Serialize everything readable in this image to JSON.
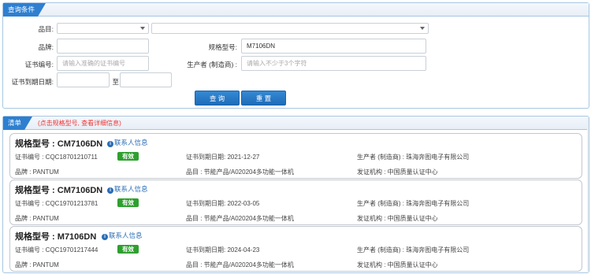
{
  "query": {
    "title": "查询条件",
    "category_label": "品目:",
    "brand_label": "品牌:",
    "brand_value": "",
    "model_label": "规格型号:",
    "model_value": "M7106DN",
    "cert_label": "证书编号:",
    "cert_placeholder": "请输入准确的证书编号",
    "producer_label": "生产者  (制造商) :",
    "producer_placeholder": "请输入不少于3个字符",
    "expire_label": "证书到期日期:",
    "to_label": "至",
    "search_button": "查 询",
    "reset_button": "重 置"
  },
  "list": {
    "title": "清单",
    "hint": "(点击规格型号, 查看详细信息)",
    "items": [
      {
        "model": "规格型号 : CM7106DN",
        "contact": "联系人信息",
        "cert_no": "证书编号 : CQC18701210711",
        "status": "有效",
        "expire": "证书到期日期: 2021-12-27",
        "producer": "生产者  (制造商) : 珠海奔图电子有限公司",
        "brand": "品牌 : PANTUM",
        "category": "品目 : 节能产品/A020204多功能一体机",
        "issuer": "发证机构 : 中国质量认证中心"
      },
      {
        "model": "规格型号 : CM7106DN",
        "contact": "联系人信息",
        "cert_no": "证书编号 : CQC19701213781",
        "status": "有效",
        "expire": "证书到期日期: 2022-03-05",
        "producer": "生产者  (制造商) : 珠海奔图电子有限公司",
        "brand": "品牌 : PANTUM",
        "category": "品目 : 节能产品/A020204多功能一体机",
        "issuer": "发证机构 : 中国质量认证中心"
      },
      {
        "model": "规格型号 : M7106DN",
        "contact": "联系人信息",
        "cert_no": "证书编号 : CQC19701217444",
        "status": "有效",
        "expire": "证书到期日期: 2024-04-23",
        "producer": "生产者  (制造商) : 珠海奔图电子有限公司",
        "brand": "品牌 : PANTUM",
        "category": "品目 : 节能产品/A020204多功能一体机",
        "issuer": "发证机构 : 中国质量认证中心"
      }
    ]
  },
  "colors": {
    "accent": "#2e7fd0",
    "valid": "#2ea02e",
    "hint": "#e33333"
  }
}
